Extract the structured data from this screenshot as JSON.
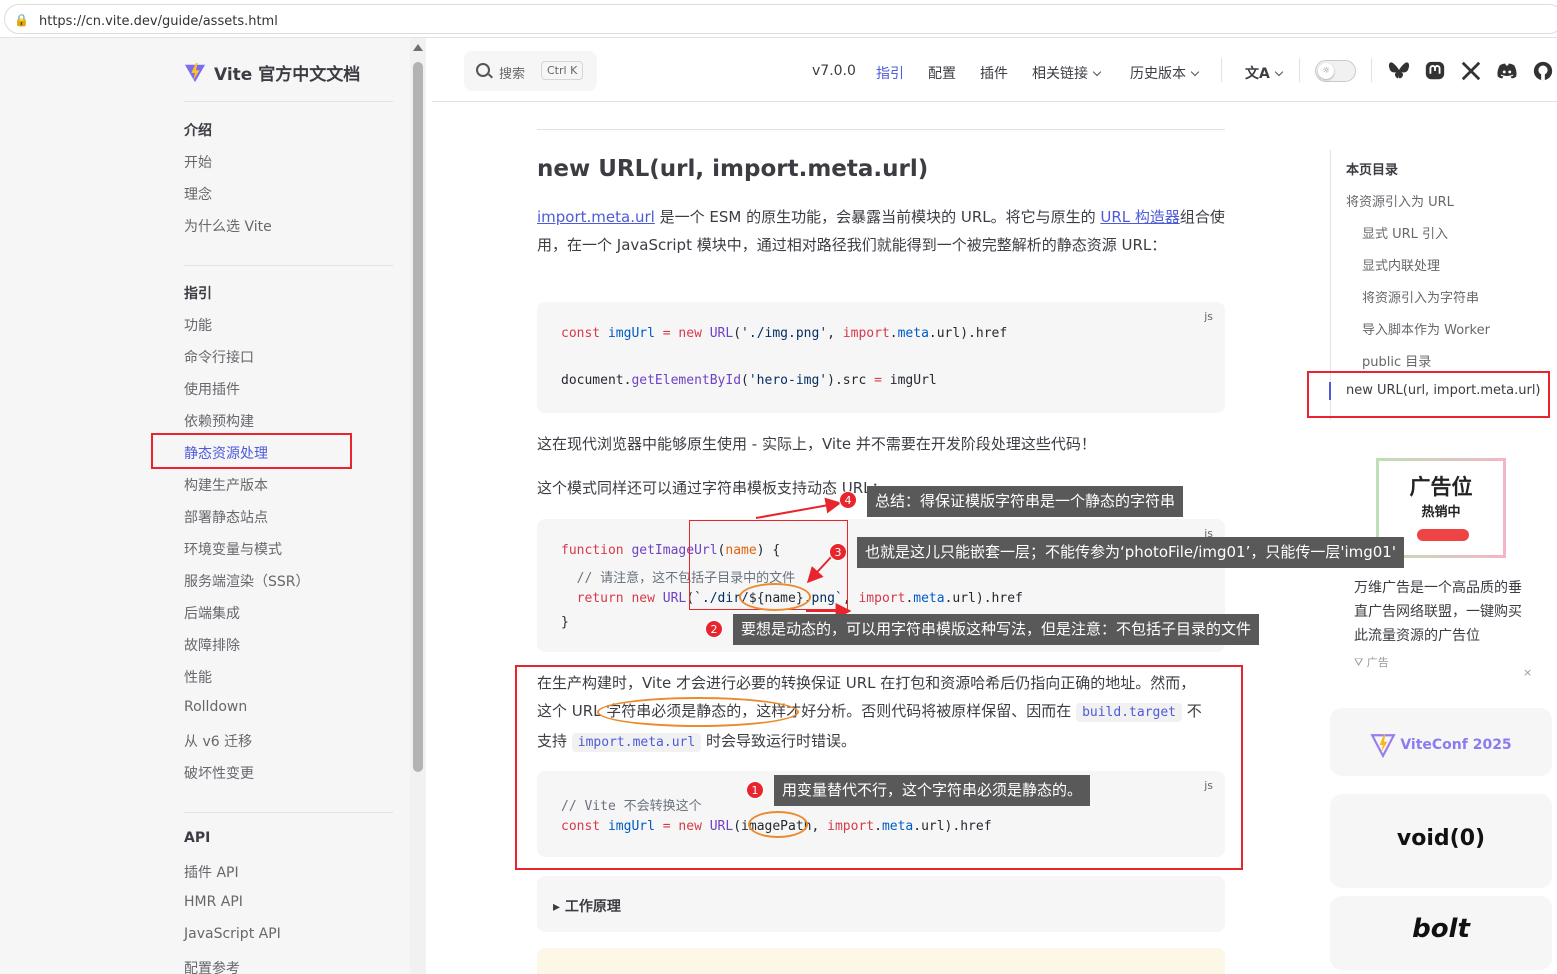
{
  "browser": {
    "url": "https://cn.vite.dev/guide/assets.html"
  },
  "site": {
    "title": "Vite 官方中文文档"
  },
  "sidebar": {
    "intro_heading": "介绍",
    "intro_items": [
      "开始",
      "理念",
      "为什么选 Vite"
    ],
    "guide_heading": "指引",
    "guide_items": [
      "功能",
      "命令行接口",
      "使用插件",
      "依赖预构建",
      "静态资源处理",
      "构建生产版本",
      "部署静态站点",
      "环境变量与模式",
      "服务端渲染（SSR）",
      "后端集成",
      "故障排除",
      "性能",
      "Rolldown",
      "从 v6 迁移",
      "破坏性变更"
    ],
    "active_item": "静态资源处理",
    "api_heading": "API",
    "api_items": [
      "插件 API",
      "HMR API",
      "JavaScript API",
      "配置参考"
    ]
  },
  "nav": {
    "search_label": "搜索",
    "search_kbd": "Ctrl K",
    "version": "v7.0.0",
    "links": [
      "指引",
      "配置",
      "插件",
      "相关链接",
      "历史版本"
    ],
    "active_link": "指引",
    "icons": [
      "translate-icon",
      "theme-toggle",
      "bluesky-icon",
      "mastodon-icon",
      "x-icon",
      "discord-icon",
      "github-icon"
    ]
  },
  "main": {
    "heading": "new URL(url, import.meta.url)",
    "intro": {
      "link1": "import.meta.url",
      "text1": " 是一个 ESM 的原生功能，会暴露当前模块的 URL。将它与原生的 ",
      "link2": "URL 构造器",
      "text2": "组合使用，在一个 JavaScript 模块中，通过相对路径我们就能得到一个被完整解析的静态资源 URL："
    },
    "code1": {
      "lang": "js",
      "line1": {
        "k1": "const",
        "v1": " imgUrl",
        "op": " = ",
        "k2": "new",
        "f1": " URL",
        "a": "(",
        "s1": "'./img.png'",
        "b": ", ",
        "k3": "import",
        "c": ".",
        "v2": "meta",
        "d": ".url).href"
      },
      "line2": {
        "a": "document.",
        "f1": "getElementById",
        "b": "(",
        "s1": "'hero-img'",
        "c": ").src ",
        "op": "=",
        "d": " imgUrl"
      }
    },
    "p2": "这在现代浏览器中能够原生使用 - 实际上，Vite 并不需要在开发阶段处理这些代码！",
    "p3": "这个模式同样还可以通过字符串模板支持动态 URL：",
    "code2": {
      "lang": "js",
      "l1": {
        "k": "function",
        "f": " getImageUrl",
        "a": "(",
        "p": "name",
        "b": ") {"
      },
      "l2": "  // 请注意，这不包括子目录中的文件",
      "l3": {
        "k": "  return",
        "k2": " new",
        "f": " URL",
        "a": "(",
        "s1": "`./dir/",
        "t": "${name}",
        "s2": ".png`",
        "b": ", ",
        "k3": "import",
        "c": ".",
        "v": "meta",
        "d": ".url).href"
      },
      "l4": "}"
    },
    "p4": {
      "a": "在生产构建时，Vite 才会进行必要的转换保证 URL 在打包和资源哈希后仍指向正确的地址。然而，这个 URL 字符串必须是静态的，这样才好分析。否则代码将被原样保留、因而在 ",
      "code1": "build.target",
      "b": " 不支持 ",
      "code2": "import.meta.url",
      "c": " 时会导致运行时错误。"
    },
    "code3": {
      "lang": "js",
      "l1": "// Vite 不会转换这个",
      "l2": {
        "k": "const",
        "v": " imgUrl",
        "op": " = ",
        "k2": "new",
        "f": " URL",
        "a": "(imagePath, ",
        "k3": "import",
        "c": ".",
        "v2": "meta",
        "d": ".url).href"
      }
    },
    "details_label": "工作原理"
  },
  "toc": {
    "title": "本页目录",
    "items": [
      "将资源引入为 URL",
      "显式 URL 引入",
      "显式内联处理",
      "将资源引入为字符串",
      "导入脚本作为 Worker",
      "public 目录",
      "new URL(url, import.meta.url)"
    ],
    "active": "new URL(url, import.meta.url)"
  },
  "ad": {
    "img_title": "广告位",
    "img_sub": "热销中",
    "text": "万维广告是一个高品质的垂直广告网络联盟，一键购买此流量资源的广告位",
    "tag": "广告",
    "close": "×"
  },
  "sponsors": [
    "ViteConf 2025",
    "void(0)",
    "bolt"
  ],
  "annotations": {
    "n1": "1",
    "c1": "用变量替代不行，这个字符串必须是静态的。",
    "n2": "2",
    "c2": "要想是动态的，可以用字符串模版这种写法，但是注意：不包括子目录的文件",
    "n3": "3",
    "c3": "也就是这儿只能嵌套一层；不能传参为‘photoFile/img01’，只能传一层'img01'",
    "n4": "4",
    "c4": "总结：得保证模版字符串是一个静态的字符串",
    "color": "#e8242c",
    "oval_color": "#ec8a2f"
  }
}
